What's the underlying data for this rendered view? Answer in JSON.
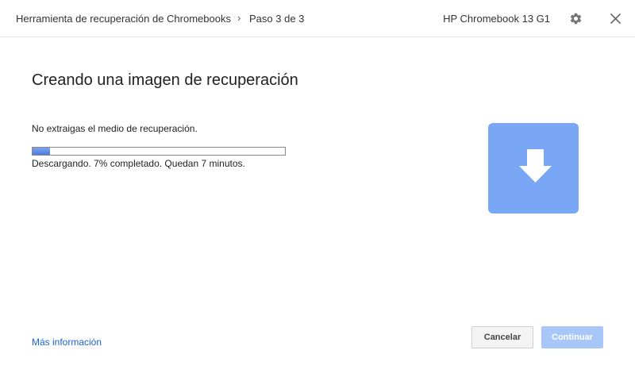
{
  "header": {
    "app_name": "Herramienta de recuperación de Chromebooks",
    "separator": "›",
    "step": "Paso 3 de 3",
    "device": "HP Chromebook 13 G1",
    "settings_icon": "gear-icon",
    "close_icon": "close-icon"
  },
  "main": {
    "title": "Creando una imagen de recuperación",
    "instruction": "No extraigas el medio de recuperación.",
    "progress_percent": 7,
    "status": "Descargando. 7% completado. Quedan 7 minutos.",
    "download_icon": "download-arrow-icon",
    "accent_color": "#7aa7f5"
  },
  "footer": {
    "more_info_link": "Más información",
    "cancel_label": "Cancelar",
    "continue_label": "Continuar",
    "continue_enabled": false
  }
}
